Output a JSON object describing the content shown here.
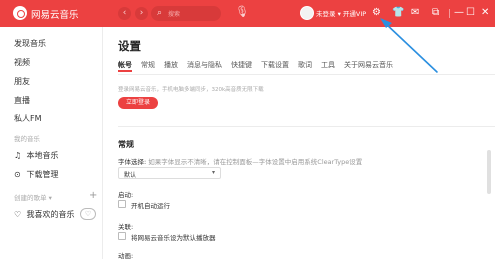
{
  "titlebar": {
    "app_title": "网易云音乐",
    "back_icon": "‹",
    "forward_icon": "›",
    "search_icon": "⌕",
    "search_placeholder": "搜索",
    "mic_icon": "🎙",
    "user_text": "未登录 ▾  开通VIP",
    "settings_icon": "⚙",
    "skin_icon": "👕",
    "mail_icon": "✉",
    "mini_icon": "⧉",
    "minimize_icon": "—",
    "maximize_icon": "☐",
    "close_icon": "✕",
    "accent": "#ec4141"
  },
  "sidebar": {
    "items": [
      {
        "label": "发现音乐"
      },
      {
        "label": "视频"
      },
      {
        "label": "朋友"
      },
      {
        "label": "直播"
      },
      {
        "label": "私人FM"
      }
    ],
    "my_music_heading": "我的音乐",
    "my_music": [
      {
        "icon": "♫",
        "label": "本地音乐"
      },
      {
        "icon": "⊙",
        "label": "下载管理"
      }
    ],
    "created_heading": "创建的歌单 ▾",
    "add_icon": "+",
    "liked": {
      "icon": "♡",
      "label": "我喜欢的音乐",
      "heart_mode_icon": "♡"
    }
  },
  "main": {
    "title": "设置",
    "tabs": [
      {
        "label": "帐号",
        "active": true
      },
      {
        "label": "常规",
        "active": false
      },
      {
        "label": "播放",
        "active": false
      },
      {
        "label": "消息与隐私",
        "active": false
      },
      {
        "label": "快捷键",
        "active": false
      },
      {
        "label": "下载设置",
        "active": false
      },
      {
        "label": "歌词",
        "active": false
      },
      {
        "label": "工具",
        "active": false
      },
      {
        "label": "关于网易云音乐",
        "active": false
      }
    ],
    "login_hint": "登录网易云音乐，手机电脑多端同步，320k高音质无限下载",
    "login_button": "立即登录",
    "general_title": "常规",
    "font_label": "字体选择:",
    "font_hint": "如果字体显示不清晰，请在控制面板—字体设置中启用系统ClearType设置",
    "font_value": "默认",
    "startup_label": "启动:",
    "startup_option": "开机自动运行",
    "association_label": "关联:",
    "association_option": "将网易云音乐设为默认播放器",
    "animation_label": "动画:"
  }
}
